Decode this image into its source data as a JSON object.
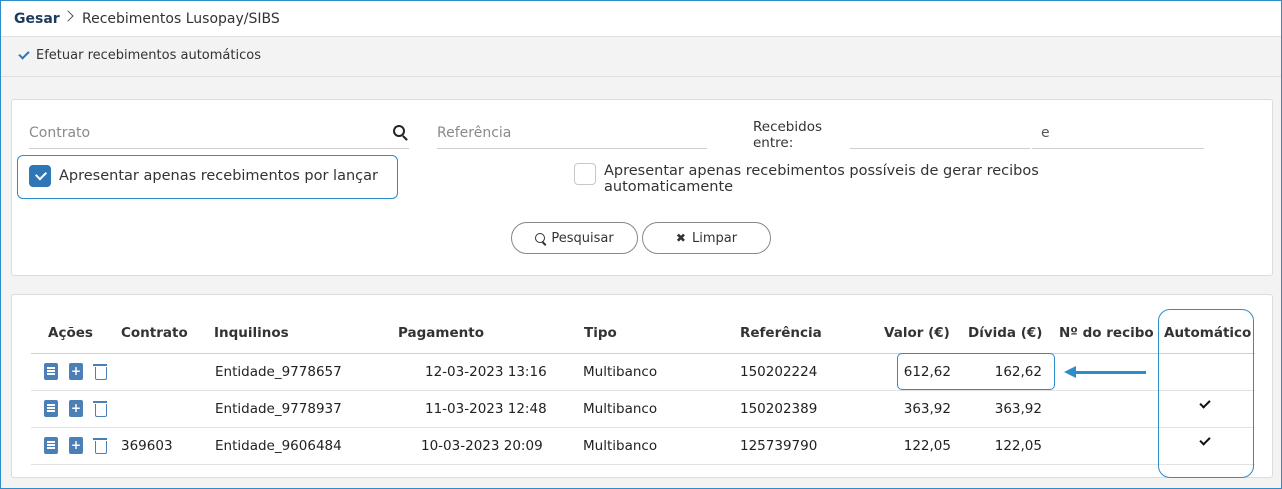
{
  "breadcrumb": {
    "root": "Gesar",
    "page": "Recebimentos Lusopay/SIBS"
  },
  "actionbar": {
    "label": "Efetuar recebimentos automáticos"
  },
  "filters": {
    "contrato_placeholder": "Contrato",
    "referencia_placeholder": "Referência",
    "recebidos_label_line1": "Recebidos",
    "recebidos_label_line2": "entre:",
    "e_label": "e",
    "check_por_lancar": {
      "label": "Apresentar apenas recebimentos por lançar",
      "checked": true
    },
    "check_gerar": {
      "label_line1": "Apresentar apenas recebimentos possíveis de gerar recibos",
      "label_line2": "automaticamente",
      "checked": false
    },
    "btn_pesquisar": "Pesquisar",
    "btn_limpar": "Limpar"
  },
  "table": {
    "headers": {
      "acoes": "Ações",
      "contrato": "Contrato",
      "inquilinos": "Inquilinos",
      "pagamento": "Pagamento",
      "tipo": "Tipo",
      "referencia": "Referência",
      "valor": "Valor (€)",
      "divida": "Dívida (€)",
      "recibo": "Nº do recibo",
      "automatico": "Automático"
    },
    "rows": [
      {
        "contrato": "",
        "inquilino": "Entidade_9778657",
        "pagamento": "12-03-2023 13:16",
        "tipo": "Multibanco",
        "referencia": "150202224",
        "valor": "612,62",
        "divida": "162,62",
        "recibo": "",
        "automatico": false
      },
      {
        "contrato": "",
        "inquilino": "Entidade_9778937",
        "pagamento": "11-03-2023 12:48",
        "tipo": "Multibanco",
        "referencia": "150202389",
        "valor": "363,92",
        "divida": "363,92",
        "recibo": "",
        "automatico": true
      },
      {
        "contrato": "369603",
        "inquilino": "Entidade_9606484",
        "pagamento": "10-03-2023 20:09",
        "tipo": "Multibanco",
        "referencia": "125739790",
        "valor": "122,05",
        "divida": "122,05",
        "recibo": "",
        "automatico": true
      }
    ]
  },
  "colors": {
    "accent": "#2e8cc8",
    "brand": "#1f3b5c",
    "icon": "#4b7fb5"
  }
}
